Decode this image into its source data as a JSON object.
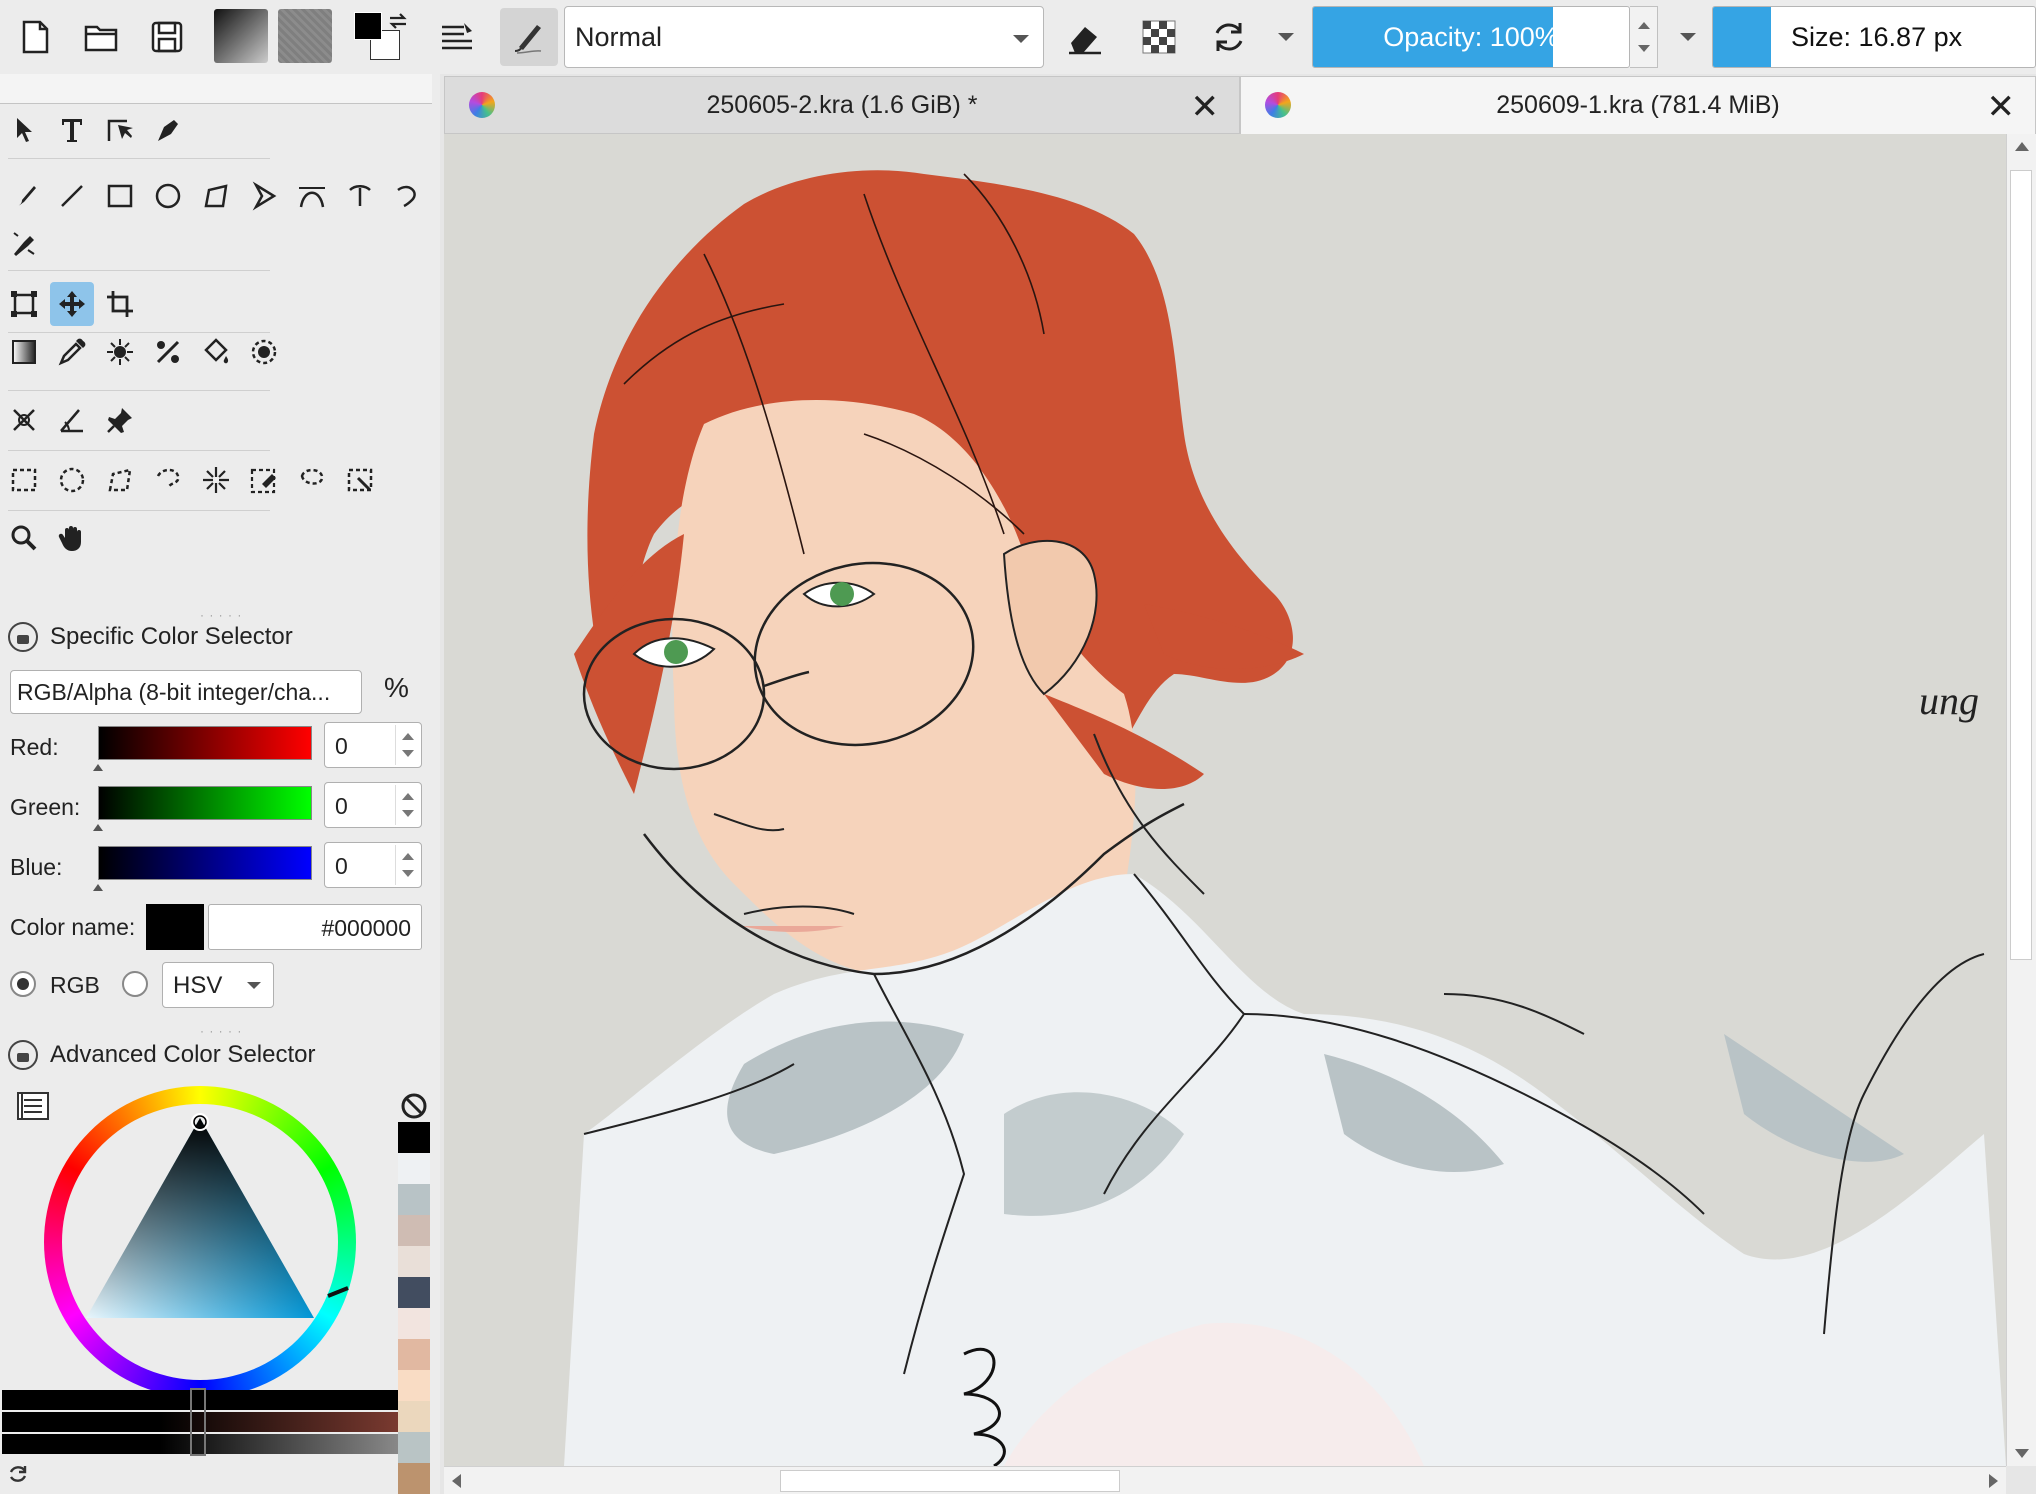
{
  "toolbar": {
    "blend_mode": "Normal",
    "opacity_label": "Opacity: 100%",
    "opacity_value": 1.0,
    "size_label": "Size: 16.87 px",
    "size_fill": 0.18,
    "icons": [
      "new-document-icon",
      "open-document-icon",
      "save-icon",
      "gradient-icon",
      "pattern-icon",
      "fg-bg-color-icon",
      "brush-settings-icon",
      "brush-preset-icon",
      "eraser-icon",
      "alpha-lock-icon",
      "reload-preset-icon"
    ]
  },
  "tabs": [
    {
      "title": "250605-2.kra (1.6 GiB) *",
      "active": false
    },
    {
      "title": "250609-1.kra (781.4 MiB)",
      "active": true
    }
  ],
  "toolbox": {
    "active_tool": "move-tool"
  },
  "specific_color_selector": {
    "title": "Specific Color Selector",
    "model": "RGB/Alpha (8-bit integer/cha...",
    "percent_symbol": "%",
    "channels": [
      {
        "label": "Red:",
        "value": "0",
        "color": "#ff0000"
      },
      {
        "label": "Green:",
        "value": "0",
        "color": "#00ff00"
      },
      {
        "label": "Blue:",
        "value": "0",
        "color": "#0000ff"
      }
    ],
    "color_name_label": "Color name:",
    "hex": "#000000",
    "swatch_color": "#000000",
    "radio_rgb": "RGB",
    "radio_hsv": "HSV",
    "select_hsv": "HSV"
  },
  "advanced_color_selector": {
    "title": "Advanced Color Selector"
  },
  "color_history": [
    "#000000",
    "#eef1f3",
    "#b8c3c6",
    "#cfbcb3",
    "#e9dfd8",
    "#424d60",
    "#f2e4df",
    "#e1b8a1",
    "#f9dcc4",
    "#ebd7bd",
    "#b9c4c5",
    "#bc936e"
  ],
  "canvas": {
    "background": "#d9d9d4",
    "hair_color": "#cc5133",
    "skin_color": "#f6d3bb",
    "shirt_color": "#eef1f3",
    "shadow_color": "#b9c3c6",
    "eye_color": "#4e9a52",
    "partial_text": "ung"
  }
}
